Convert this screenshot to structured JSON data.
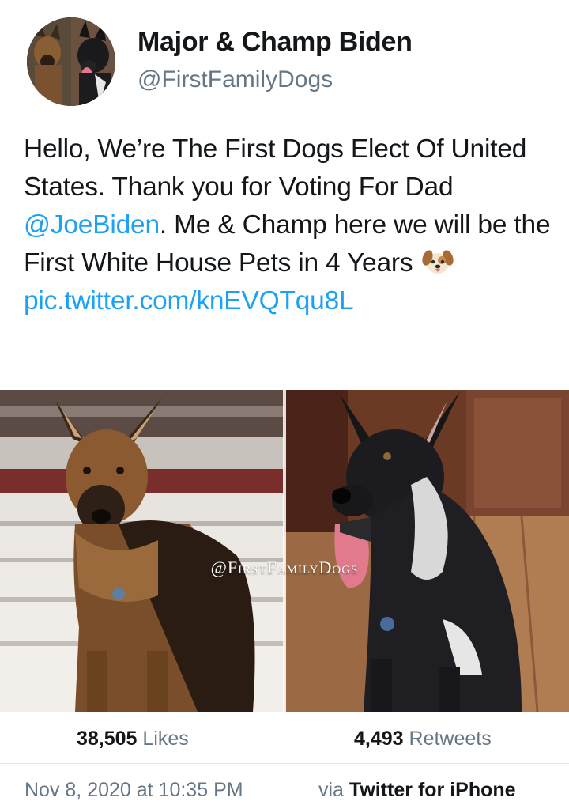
{
  "author": {
    "display_name": "Major & Champ Biden",
    "handle": "@FirstFamilyDogs"
  },
  "tweet": {
    "text_part1": "Hello, We’re The First Dogs Elect Of United States. Thank you for Voting For Dad ",
    "mention": "@JoeBiden",
    "text_part2": ". Me & Champ here we will be the First White House Pets in 4 Years ",
    "emoji": "dog-face-icon",
    "link": "pic.twitter.com/knEVQTqu8L"
  },
  "media": {
    "watermark": "@FirstFamilyDogs"
  },
  "stats": {
    "likes_count": "38,505",
    "likes_label": " Likes",
    "retweets_count": "4,493",
    "retweets_label": " Retweets"
  },
  "meta": {
    "timestamp": "Nov 8, 2020 at 10:35 PM",
    "source_prefix": "via ",
    "source_app": "Twitter for iPhone"
  },
  "colors": {
    "link": "#1da1f2",
    "secondary_text": "#657786",
    "primary_text": "#14171a",
    "divider": "#e1e8ed"
  }
}
